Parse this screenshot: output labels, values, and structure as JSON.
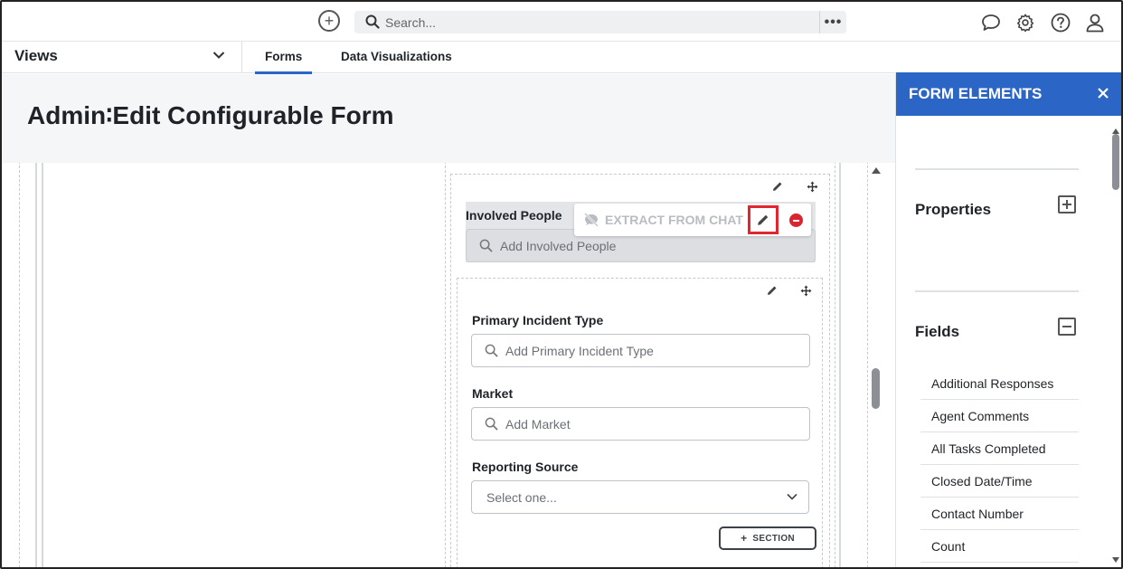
{
  "topbar": {
    "add_icon": "plus-circle-icon",
    "search_placeholder": "Search...",
    "more_icon": "ellipsis-icon",
    "icons": [
      "chat-icon",
      "gear-icon",
      "help-icon",
      "user-icon"
    ]
  },
  "nav": {
    "views_label": "Views",
    "tabs": [
      {
        "label": "Forms",
        "active": true
      },
      {
        "label": "Data Visualizations",
        "active": false
      }
    ]
  },
  "page": {
    "title": "Admin∶Edit Configurable Form"
  },
  "form": {
    "involved_people": {
      "label": "Involved People",
      "placeholder": "Add Involved People"
    },
    "toolbar": {
      "extract_label": "EXTRACT FROM CHAT"
    },
    "fields": [
      {
        "label": "Primary Incident Type",
        "placeholder": "Add Primary Incident Type"
      },
      {
        "label": "Market",
        "placeholder": "Add Market"
      }
    ],
    "reporting_source": {
      "label": "Reporting Source",
      "placeholder": "Select one..."
    },
    "section_button": "SECTION"
  },
  "panel": {
    "title": "FORM ELEMENTS",
    "properties_label": "Properties",
    "fields_label": "Fields",
    "field_items": [
      "Additional Responses",
      "Agent Comments",
      "All Tasks Completed",
      "Closed Date/Time",
      "Contact Number",
      "Count"
    ]
  },
  "colors": {
    "accent": "#2b66c6",
    "danger": "#d7262d",
    "highlight_border": "#e0262e"
  }
}
